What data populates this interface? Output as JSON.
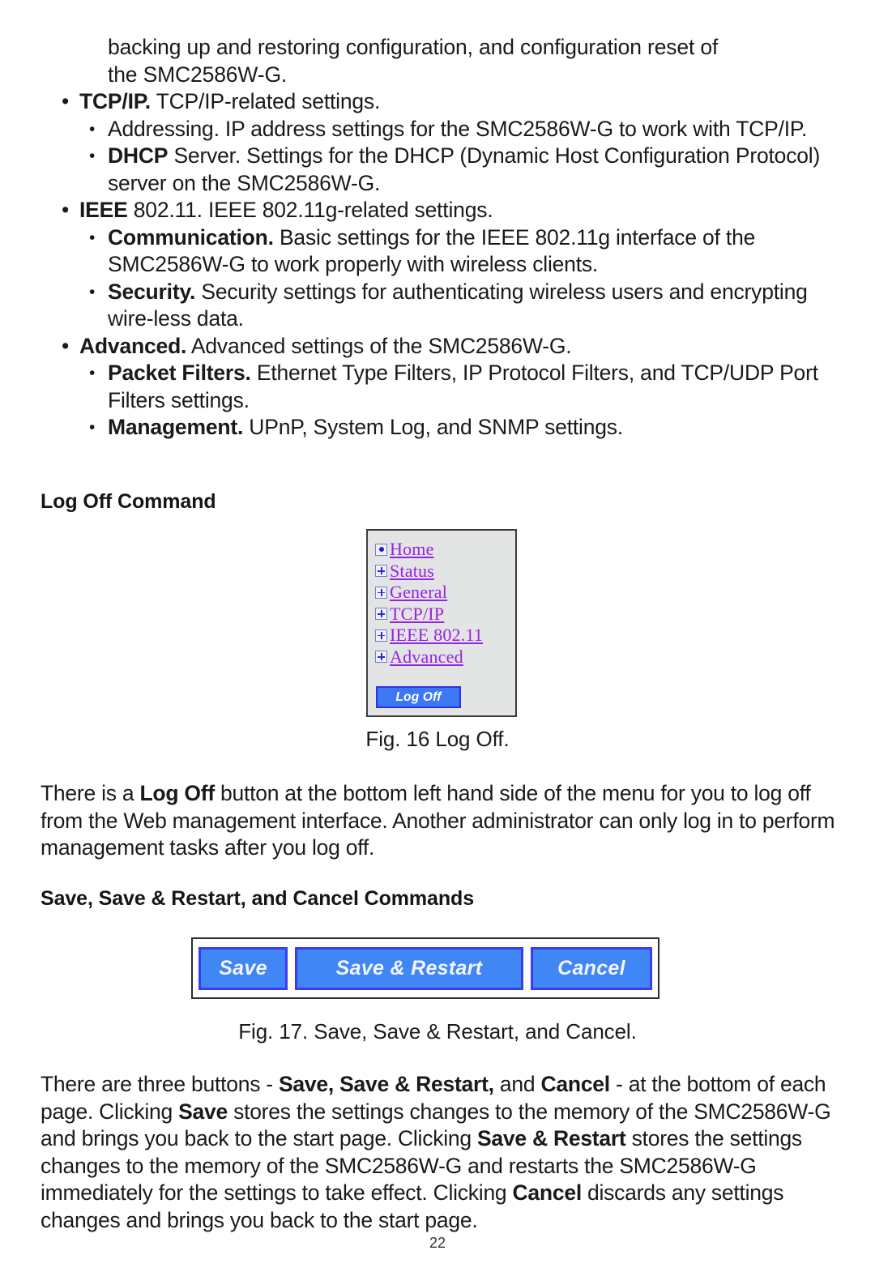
{
  "bullets": {
    "continuation_line": "backing up and restoring configuration, and configuration reset of\nthe SMC2586W-G.",
    "items": [
      {
        "level": 1,
        "bold": "TCP/IP.",
        "rest": " TCP/IP-related settings."
      },
      {
        "level": 2,
        "bold": "",
        "rest": "Addressing. IP address settings for the SMC2586W-G to work with TCP/IP."
      },
      {
        "level": 2,
        "bold": "DHCP",
        "rest": " Server. Settings for the DHCP (Dynamic Host Configuration Protocol) server on the SMC2586W-G."
      },
      {
        "level": 1,
        "bold": "IEEE",
        "rest": " 802.11. IEEE 802.11g-related settings."
      },
      {
        "level": 2,
        "bold": "Communication.",
        "rest": " Basic settings for the IEEE 802.11g interface of the SMC2586W-G to work properly with wireless clients."
      },
      {
        "level": 2,
        "bold": "Security.",
        "rest": " Security settings for authenticating wireless users and encrypting wire-less data."
      },
      {
        "level": 1,
        "bold": "Advanced.",
        "rest": " Advanced settings of the SMC2586W-G."
      },
      {
        "level": 2,
        "bold": "Packet Filters.",
        "rest": " Ethernet Type Filters, IP Protocol Filters, and TCP/UDP Port Filters settings."
      },
      {
        "level": 2,
        "bold": "Management.",
        "rest": " UPnP, System Log, and SNMP settings."
      }
    ],
    "marker": "•"
  },
  "headings": {
    "logoff": "Log Off Command",
    "save": "Save, Save & Restart, and Cancel Commands"
  },
  "figure16": {
    "caption": "Fig. 16 Log Off.",
    "menu_items": [
      {
        "label": "Home",
        "icon": "radio-dot-icon"
      },
      {
        "label": "Status",
        "icon": "expand-plus-icon"
      },
      {
        "label": "General",
        "icon": "expand-plus-icon"
      },
      {
        "label": "TCP/IP",
        "icon": "expand-plus-icon"
      },
      {
        "label": "IEEE 802.11",
        "icon": "expand-plus-icon"
      },
      {
        "label": "Advanced",
        "icon": "expand-plus-icon"
      }
    ],
    "logoff_button": "Log Off",
    "colors": {
      "panel_background": "#e3e4e4",
      "link": "#9821e8",
      "button_face": "#3d78f4",
      "button_border": "#2f2fe0"
    }
  },
  "figure17": {
    "caption": "Fig. 17. Save, Save & Restart, and Cancel.",
    "buttons": [
      {
        "label": "Save"
      },
      {
        "label": "Save & Restart"
      },
      {
        "label": "Cancel"
      }
    ],
    "colors": {
      "button_face": "#4086f4",
      "button_border": "#3b3bf0"
    }
  },
  "paragraphs": {
    "logoff": [
      {
        "t": "There is a ",
        "b": false
      },
      {
        "t": "Log Off",
        "b": true
      },
      {
        "t": " button at the bottom left hand side of the menu for you to log off from the Web management interface. Another administrator can only log in to perform management tasks after you log off.",
        "b": false
      }
    ],
    "save": [
      {
        "t": "There are three buttons - ",
        "b": false
      },
      {
        "t": "Save, Save & Restart,",
        "b": true
      },
      {
        "t": " and ",
        "b": false
      },
      {
        "t": "Cancel",
        "b": true
      },
      {
        "t": " - at the bottom of each page. Clicking ",
        "b": false
      },
      {
        "t": "Save",
        "b": true
      },
      {
        "t": " stores the settings changes to the memory of the SMC2586W-G and brings you back to the start page. Clicking ",
        "b": false
      },
      {
        "t": "Save & Restart",
        "b": true
      },
      {
        "t": " stores the settings changes to the memory of the SMC2586W-G and restarts the SMC2586W-G immediately for the settings to take effect. Clicking ",
        "b": false
      },
      {
        "t": "Cancel",
        "b": true
      },
      {
        "t": " discards any settings changes and brings you back to the start page.",
        "b": false
      }
    ]
  },
  "page_number": "22"
}
